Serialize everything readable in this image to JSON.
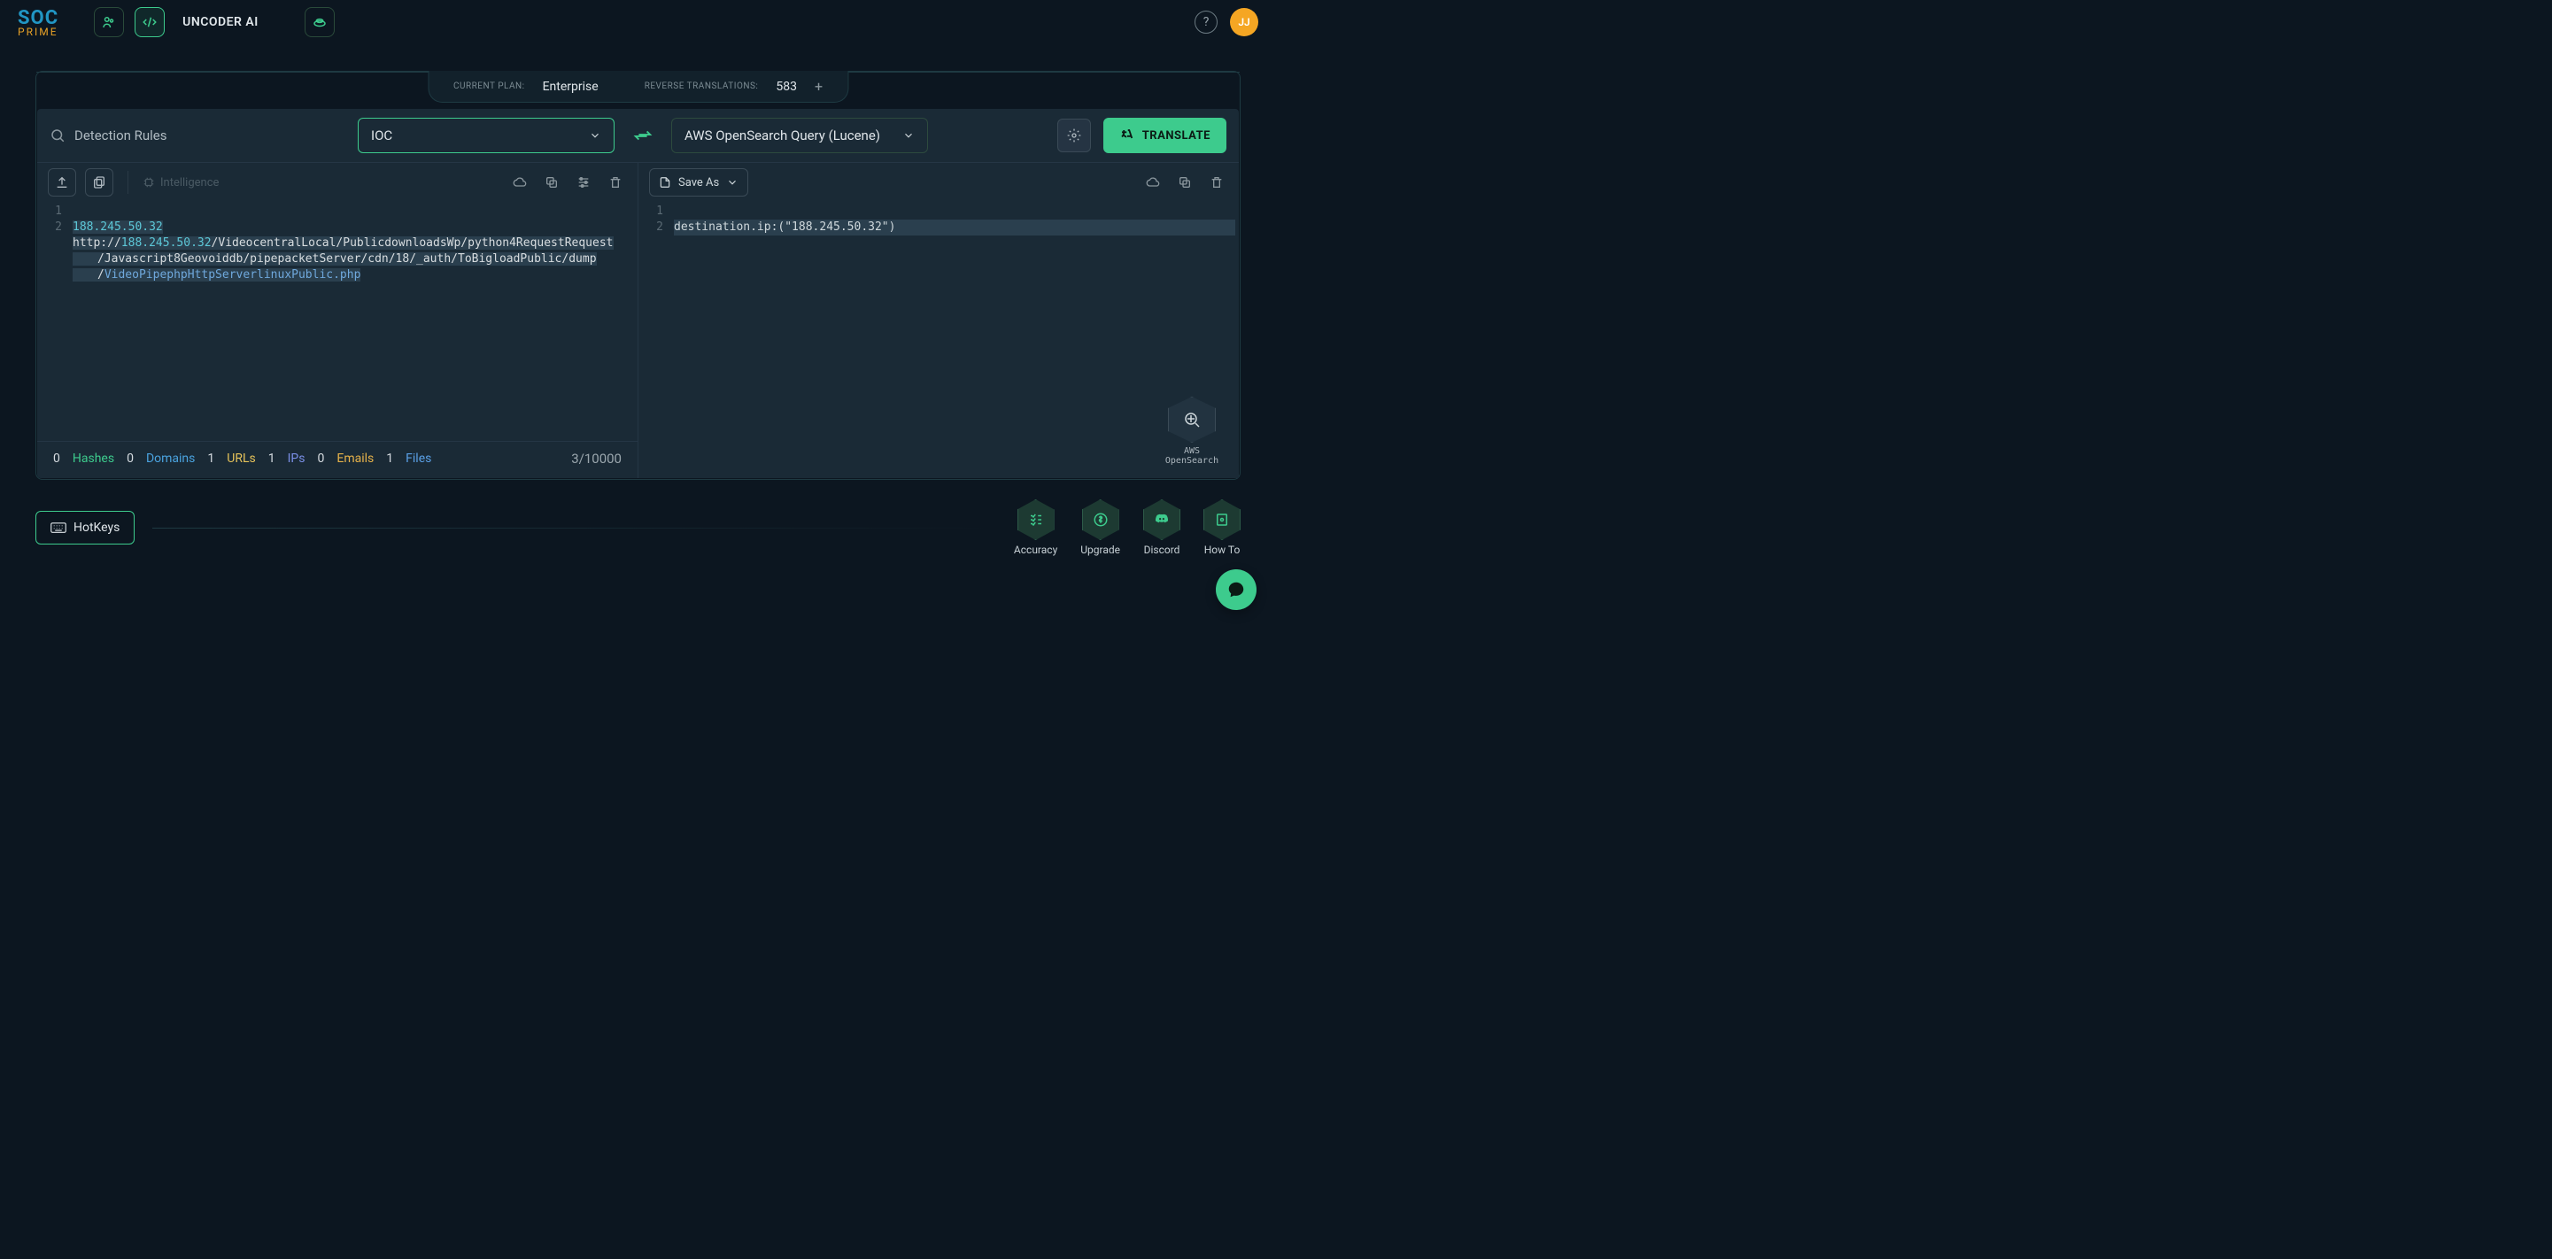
{
  "header": {
    "app_title": "UNCODER AI",
    "avatar_initials": "JJ"
  },
  "plan": {
    "current_plan_label": "CURRENT PLAN:",
    "current_plan_value": "Enterprise",
    "reverse_label": "REVERSE TRANSLATIONS:",
    "reverse_value": "583"
  },
  "toolbar": {
    "search_label": "Detection Rules",
    "left_selector": "IOC",
    "right_selector": "AWS OpenSearch Query (Lucene)",
    "translate_label": "TRANSLATE"
  },
  "left_editor": {
    "intelligence_label": "Intelligence",
    "gutter": [
      "1",
      "2"
    ],
    "line1_ip": "188.245.50.32",
    "line2_scheme": "http://",
    "line2_ip": "188.245.50.32",
    "line2_path1": "/VideocentralLocal/PublicdownloadsWp/python4RequestRequest",
    "line2_wrap1": "/Javascript8Geovoiddb/pipepacketServer/cdn/18/_auth/ToBigloadPublic/dump",
    "line2_wrap2_slash": "/",
    "line2_wrap2_file": "VideoPipephpHttpServerlinuxPublic.php"
  },
  "right_editor": {
    "save_as_label": "Save As",
    "gutter": [
      "1",
      "2"
    ],
    "line1_key": "destination.ip:",
    "line1_paren_open": "(",
    "line1_str": "\"188.245.50.32\"",
    "line1_paren_close": ")",
    "aws_badge_line1": "AWS",
    "aws_badge_line2": "OpenSearch"
  },
  "stats": {
    "hashes_n": "0",
    "hashes_l": "Hashes",
    "domains_n": "0",
    "domains_l": "Domains",
    "urls_n": "1",
    "urls_l": "URLs",
    "ips_n": "1",
    "ips_l": "IPs",
    "emails_n": "0",
    "emails_l": "Emails",
    "files_n": "1",
    "files_l": "Files",
    "counter": "3/10000"
  },
  "footer": {
    "hotkeys_label": "HotKeys",
    "accuracy": "Accuracy",
    "upgrade": "Upgrade",
    "discord": "Discord",
    "howto": "How To"
  }
}
